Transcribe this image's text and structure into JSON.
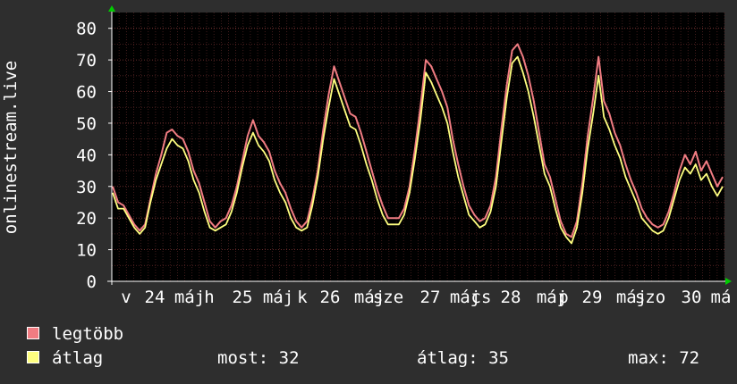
{
  "chart_data": {
    "type": "line",
    "ylabel": "onlinestream.live",
    "ylim": [
      0,
      85
    ],
    "yticks": [
      0,
      10,
      20,
      30,
      40,
      50,
      60,
      70,
      80
    ],
    "grid": true,
    "x_tick_labels": [
      "v",
      "24",
      "máj",
      "h",
      "25",
      "máj",
      "k",
      "26",
      "máj",
      "sze",
      "27",
      "máj",
      "cs",
      "28",
      "máj",
      "p",
      "29",
      "máj",
      "szo",
      "30",
      "má"
    ],
    "series": [
      {
        "name": "legtöbb",
        "color": "#f07c82",
        "points": [
          [
            0,
            30
          ],
          [
            0.25,
            25
          ],
          [
            0.5,
            24
          ],
          [
            0.75,
            21
          ],
          [
            1,
            18
          ],
          [
            1.25,
            16
          ],
          [
            1.5,
            18
          ],
          [
            1.75,
            26
          ],
          [
            2,
            34
          ],
          [
            2.25,
            40
          ],
          [
            2.5,
            47
          ],
          [
            2.75,
            48
          ],
          [
            3,
            46
          ],
          [
            3.25,
            45
          ],
          [
            3.5,
            41
          ],
          [
            3.75,
            35
          ],
          [
            4,
            31
          ],
          [
            4.25,
            25
          ],
          [
            4.5,
            19
          ],
          [
            4.75,
            17
          ],
          [
            5,
            19
          ],
          [
            5.25,
            20
          ],
          [
            5.5,
            24
          ],
          [
            5.75,
            30
          ],
          [
            6,
            38
          ],
          [
            6.25,
            46
          ],
          [
            6.5,
            51
          ],
          [
            6.75,
            46
          ],
          [
            7,
            44
          ],
          [
            7.25,
            41
          ],
          [
            7.5,
            35
          ],
          [
            7.75,
            31
          ],
          [
            8,
            28
          ],
          [
            8.25,
            23
          ],
          [
            8.5,
            19
          ],
          [
            8.75,
            17
          ],
          [
            9,
            19
          ],
          [
            9.25,
            26
          ],
          [
            9.5,
            35
          ],
          [
            9.75,
            48
          ],
          [
            10,
            59
          ],
          [
            10.25,
            68
          ],
          [
            10.5,
            63
          ],
          [
            10.75,
            58
          ],
          [
            11,
            53
          ],
          [
            11.25,
            52
          ],
          [
            11.5,
            47
          ],
          [
            11.75,
            41
          ],
          [
            12,
            35
          ],
          [
            12.25,
            29
          ],
          [
            12.5,
            24
          ],
          [
            12.75,
            20
          ],
          [
            13,
            20
          ],
          [
            13.25,
            20
          ],
          [
            13.5,
            23
          ],
          [
            13.75,
            30
          ],
          [
            14,
            42
          ],
          [
            14.25,
            55
          ],
          [
            14.5,
            70
          ],
          [
            14.75,
            68
          ],
          [
            15,
            64
          ],
          [
            15.25,
            60
          ],
          [
            15.5,
            55
          ],
          [
            15.75,
            45
          ],
          [
            16,
            37
          ],
          [
            16.25,
            30
          ],
          [
            16.5,
            24
          ],
          [
            16.75,
            21
          ],
          [
            17,
            19
          ],
          [
            17.25,
            20
          ],
          [
            17.5,
            24
          ],
          [
            17.75,
            33
          ],
          [
            18,
            48
          ],
          [
            18.25,
            62
          ],
          [
            18.5,
            73
          ],
          [
            18.75,
            75
          ],
          [
            19,
            71
          ],
          [
            19.25,
            65
          ],
          [
            19.5,
            57
          ],
          [
            19.75,
            47
          ],
          [
            20,
            37
          ],
          [
            20.25,
            33
          ],
          [
            20.5,
            26
          ],
          [
            20.75,
            19
          ],
          [
            21,
            15
          ],
          [
            21.25,
            14
          ],
          [
            21.5,
            19
          ],
          [
            21.75,
            31
          ],
          [
            22,
            46
          ],
          [
            22.25,
            58
          ],
          [
            22.5,
            71
          ],
          [
            22.75,
            57
          ],
          [
            23,
            53
          ],
          [
            23.25,
            47
          ],
          [
            23.5,
            43
          ],
          [
            23.75,
            37
          ],
          [
            24,
            32
          ],
          [
            24.25,
            28
          ],
          [
            24.5,
            23
          ],
          [
            24.75,
            20
          ],
          [
            25,
            18
          ],
          [
            25.25,
            17
          ],
          [
            25.5,
            18
          ],
          [
            25.75,
            22
          ],
          [
            26,
            28
          ],
          [
            26.25,
            35
          ],
          [
            26.5,
            40
          ],
          [
            26.75,
            37
          ],
          [
            27,
            41
          ],
          [
            27.25,
            35
          ],
          [
            27.5,
            38
          ],
          [
            27.75,
            34
          ],
          [
            28,
            30
          ],
          [
            28.25,
            33
          ]
        ]
      },
      {
        "name": "átlag",
        "color": "#ffff80",
        "points": [
          [
            0,
            28
          ],
          [
            0.25,
            23
          ],
          [
            0.5,
            23
          ],
          [
            0.75,
            20
          ],
          [
            1,
            17
          ],
          [
            1.25,
            15
          ],
          [
            1.5,
            17
          ],
          [
            1.75,
            25
          ],
          [
            2,
            32
          ],
          [
            2.25,
            37
          ],
          [
            2.5,
            42
          ],
          [
            2.75,
            45
          ],
          [
            3,
            43
          ],
          [
            3.25,
            42
          ],
          [
            3.5,
            38
          ],
          [
            3.75,
            32
          ],
          [
            4,
            28
          ],
          [
            4.25,
            22
          ],
          [
            4.5,
            17
          ],
          [
            4.75,
            16
          ],
          [
            5,
            17
          ],
          [
            5.25,
            18
          ],
          [
            5.5,
            22
          ],
          [
            5.75,
            28
          ],
          [
            6,
            36
          ],
          [
            6.25,
            43
          ],
          [
            6.5,
            47
          ],
          [
            6.75,
            43
          ],
          [
            7,
            41
          ],
          [
            7.25,
            38
          ],
          [
            7.5,
            32
          ],
          [
            7.75,
            28
          ],
          [
            8,
            25
          ],
          [
            8.25,
            20
          ],
          [
            8.5,
            17
          ],
          [
            8.75,
            16
          ],
          [
            9,
            17
          ],
          [
            9.25,
            24
          ],
          [
            9.5,
            33
          ],
          [
            9.75,
            45
          ],
          [
            10,
            55
          ],
          [
            10.25,
            64
          ],
          [
            10.5,
            59
          ],
          [
            10.75,
            54
          ],
          [
            11,
            49
          ],
          [
            11.25,
            48
          ],
          [
            11.5,
            43
          ],
          [
            11.75,
            37
          ],
          [
            12,
            32
          ],
          [
            12.25,
            26
          ],
          [
            12.5,
            21
          ],
          [
            12.75,
            18
          ],
          [
            13,
            18
          ],
          [
            13.25,
            18
          ],
          [
            13.5,
            21
          ],
          [
            13.75,
            28
          ],
          [
            14,
            39
          ],
          [
            14.25,
            51
          ],
          [
            14.5,
            66
          ],
          [
            14.75,
            63
          ],
          [
            15,
            59
          ],
          [
            15.25,
            55
          ],
          [
            15.5,
            50
          ],
          [
            15.75,
            41
          ],
          [
            16,
            33
          ],
          [
            16.25,
            27
          ],
          [
            16.5,
            21
          ],
          [
            16.75,
            19
          ],
          [
            17,
            17
          ],
          [
            17.25,
            18
          ],
          [
            17.5,
            22
          ],
          [
            17.75,
            30
          ],
          [
            18,
            44
          ],
          [
            18.25,
            58
          ],
          [
            18.5,
            69
          ],
          [
            18.75,
            71
          ],
          [
            19,
            66
          ],
          [
            19.25,
            60
          ],
          [
            19.5,
            52
          ],
          [
            19.75,
            43
          ],
          [
            20,
            34
          ],
          [
            20.25,
            30
          ],
          [
            20.5,
            23
          ],
          [
            20.75,
            17
          ],
          [
            21,
            14
          ],
          [
            21.25,
            12
          ],
          [
            21.5,
            17
          ],
          [
            21.75,
            28
          ],
          [
            22,
            42
          ],
          [
            22.25,
            53
          ],
          [
            22.5,
            65
          ],
          [
            22.75,
            52
          ],
          [
            23,
            48
          ],
          [
            23.25,
            43
          ],
          [
            23.5,
            39
          ],
          [
            23.75,
            33
          ],
          [
            24,
            29
          ],
          [
            24.25,
            25
          ],
          [
            24.5,
            20
          ],
          [
            24.75,
            18
          ],
          [
            25,
            16
          ],
          [
            25.25,
            15
          ],
          [
            25.5,
            16
          ],
          [
            25.75,
            20
          ],
          [
            26,
            26
          ],
          [
            26.25,
            32
          ],
          [
            26.5,
            36
          ],
          [
            26.75,
            34
          ],
          [
            27,
            37
          ],
          [
            27.25,
            32
          ],
          [
            27.5,
            34
          ],
          [
            27.75,
            30
          ],
          [
            28,
            27
          ],
          [
            28.25,
            30
          ]
        ]
      }
    ]
  },
  "legend": [
    {
      "label": "legtöbb",
      "color": "#f07c82"
    },
    {
      "label": "átlag",
      "color": "#ffff80"
    }
  ],
  "stats": {
    "now": "most: 32",
    "avg": "átlag: 35",
    "max": "max: 72"
  }
}
